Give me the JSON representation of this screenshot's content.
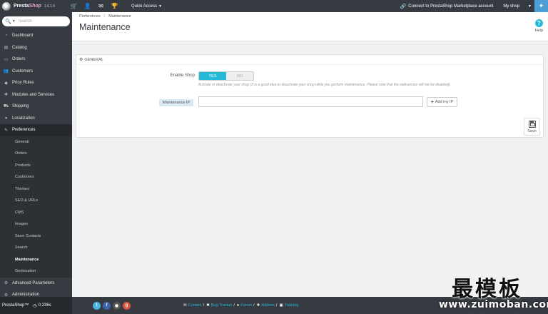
{
  "header": {
    "brand_name_presta": "Presta",
    "brand_name_shop": "Shop",
    "version": "1.6.1.5",
    "icons": [
      "cart-icon",
      "user-icon",
      "envelope-icon",
      "trophy-icon"
    ],
    "quick_access_label": "Quick Access",
    "connect_label": "Connect to PrestaShop Marketplace account",
    "my_shop_label": "My shop"
  },
  "sidebar": {
    "search_placeholder": "Search",
    "menu": [
      {
        "label": "Dashboard",
        "icon": "dashboard-icon"
      },
      {
        "label": "Catalog",
        "icon": "book-icon"
      },
      {
        "label": "Orders",
        "icon": "credit-card-icon"
      },
      {
        "label": "Customers",
        "icon": "users-icon"
      },
      {
        "label": "Price Rules",
        "icon": "tag-icon"
      },
      {
        "label": "Modules and Services",
        "icon": "puzzle-icon"
      },
      {
        "label": "Shipping",
        "icon": "truck-icon"
      },
      {
        "label": "Localization",
        "icon": "globe-icon"
      },
      {
        "label": "Preferences",
        "icon": "wrench-icon"
      }
    ],
    "submenu": [
      {
        "label": "General"
      },
      {
        "label": "Orders"
      },
      {
        "label": "Products"
      },
      {
        "label": "Customers"
      },
      {
        "label": "Themes"
      },
      {
        "label": "SEO & URLs"
      },
      {
        "label": "CMS"
      },
      {
        "label": "Images"
      },
      {
        "label": "Store Contacts"
      },
      {
        "label": "Search"
      },
      {
        "label": "Maintenance"
      },
      {
        "label": "Geolocation"
      }
    ],
    "menu_after": [
      {
        "label": "Advanced Parameters",
        "icon": "cogs-icon"
      },
      {
        "label": "Administration",
        "icon": "cog-icon"
      }
    ],
    "active_menu": "Preferences",
    "active_submenu": "Maintenance"
  },
  "page": {
    "breadcrumb": [
      "Preferences",
      "Maintenance"
    ],
    "title": "Maintenance",
    "help_label": "Help"
  },
  "panel": {
    "heading": "GENERAL",
    "enable_shop_label": "Enable Shop",
    "toggle_yes": "YES",
    "toggle_no": "NO",
    "toggle_value": "YES",
    "help_text": "Activate or deactivate your shop (It is a good idea to deactivate your shop while you perform maintenance. Please note that the webservice will not be disabled).",
    "maintenance_ip_label": "Maintenance IP",
    "maintenance_ip_value": "",
    "add_ip_label": "Add my IP",
    "save_label": "Save"
  },
  "footer": {
    "brand": "PrestaShop™",
    "load_time": "0.236s",
    "socials": [
      "twitter-icon",
      "facebook-icon",
      "github-icon",
      "google-plus-icon"
    ],
    "links": [
      {
        "label": "Contact",
        "icon": "envelope-icon"
      },
      {
        "label": "Bug Tracker",
        "icon": "bug-icon"
      },
      {
        "label": "Forum",
        "icon": "comments-icon"
      },
      {
        "label": "Addons",
        "icon": "puzzle-icon"
      },
      {
        "label": "Training",
        "icon": "book-icon"
      }
    ]
  },
  "watermark": {
    "chinese": "最模板",
    "url": "www.zuimoban.com"
  },
  "colors": {
    "sidebar_bg": "#363a41",
    "accent": "#25b9d7"
  }
}
